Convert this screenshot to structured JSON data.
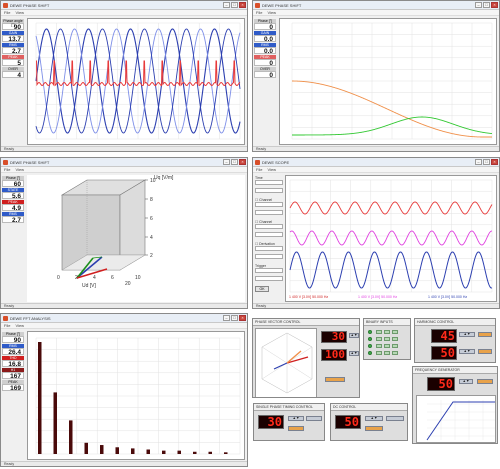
{
  "windows": [
    {
      "title": "DEWE PHASE SHIFT",
      "status": "Ready",
      "meters": [
        {
          "label": "Phase angle [°]",
          "value": "90",
          "color": "#e0e0e0",
          "text": "#111"
        },
        {
          "label": "GAIN",
          "value": "13.7",
          "color": "#2f5bc8",
          "text": "#fff"
        },
        {
          "label": "RMS",
          "value": "2.7",
          "color": "#2f5bc8",
          "text": "#fff"
        },
        {
          "label": "PEAK",
          "value": "5",
          "color": "#e06060",
          "text": "#fff"
        },
        {
          "label": "OVER",
          "value": "4",
          "color": "#e0e0e0",
          "text": "#111"
        }
      ]
    },
    {
      "title": "DEWE PHASE SHIFT",
      "status": "Ready",
      "meters": [
        {
          "label": "Phase [°]",
          "value": "0",
          "color": "#e0e0e0",
          "text": "#111"
        },
        {
          "label": "GAIN",
          "value": "0.0",
          "color": "#2f5bc8",
          "text": "#fff"
        },
        {
          "label": "RMS",
          "value": "0.0",
          "color": "#2f5bc8",
          "text": "#fff"
        },
        {
          "label": "PEAK",
          "value": "0",
          "color": "#e06060",
          "text": "#fff"
        },
        {
          "label": "OVER",
          "value": "0",
          "color": "#e0e0e0",
          "text": "#111"
        }
      ]
    },
    {
      "title": "DEWE PHASE SHIFT",
      "status": "Ready",
      "meters": [
        {
          "label": "Phase [°]",
          "value": "60",
          "color": "#e0e0e0",
          "text": "#111"
        },
        {
          "label": "STATE",
          "value": "5.6",
          "color": "#2f5bc8",
          "text": "#fff"
        },
        {
          "label": "PEAK",
          "value": "4.9",
          "color": "#d02020",
          "text": "#fff"
        },
        {
          "label": "RMS",
          "value": "2.7",
          "color": "#2f5bc8",
          "text": "#fff"
        }
      ],
      "axis_labels": {
        "z": "Uq [V/m]",
        "x": "Ud [V]"
      }
    },
    {
      "title": "DEWE SCOPE",
      "status": "Ready",
      "legend": [
        "1 400 V [3.0V] 50.000 Hz",
        "1 400 V [3.0V] 50.000 Hz",
        "1 400 V [3.0V] 50.000 Hz"
      ]
    },
    {
      "title": "DEWE FFT ANALYSIS",
      "status": "Ready",
      "meters": [
        {
          "label": "Phase [°]",
          "value": "90",
          "color": "#e0e0e0",
          "text": "#111"
        },
        {
          "label": "RMS",
          "value": "26.4",
          "color": "#2f5bc8",
          "text": "#fff"
        },
        {
          "label": "THD",
          "value": "16.8",
          "color": "#d02020",
          "text": "#fff"
        },
        {
          "label": "H1",
          "value": "167",
          "color": "#8b1a1a",
          "text": "#fff"
        },
        {
          "label": "PEAK",
          "value": "169",
          "color": "#e0e0e0",
          "text": "#111"
        }
      ]
    }
  ],
  "controls": {
    "phase_vector": {
      "title": "PHASE VECTOR CONTROL",
      "values": [
        "30",
        "100"
      ]
    },
    "binary": {
      "title": "BINARY INPUTS"
    },
    "harmonic": {
      "title": "HARMONIC CONTROL",
      "values": [
        "45",
        "50"
      ]
    },
    "single_phase": {
      "title": "SINGLE PHASE TIMING CONTROL",
      "value": "30"
    },
    "dc_control": {
      "title": "DC CONTROL",
      "value": "50"
    },
    "freq": {
      "title": "FREQUENCY GENERATOR",
      "value": "50"
    },
    "scope_btn": {
      "label": "OK"
    }
  },
  "fft_chart": {
    "type": "bar",
    "values": [
      1,
      0.55,
      0.3,
      0.1,
      0.08,
      0.06,
      0.05,
      0.04,
      0.03,
      0.03,
      0.02,
      0.02,
      0.015
    ]
  },
  "colors": {
    "red": "#e83a3a",
    "blue": "#2c3fb0",
    "lightblue": "#7e8fe8",
    "orange": "#f0904a",
    "green": "#32c832",
    "magenta": "#e040e0"
  }
}
